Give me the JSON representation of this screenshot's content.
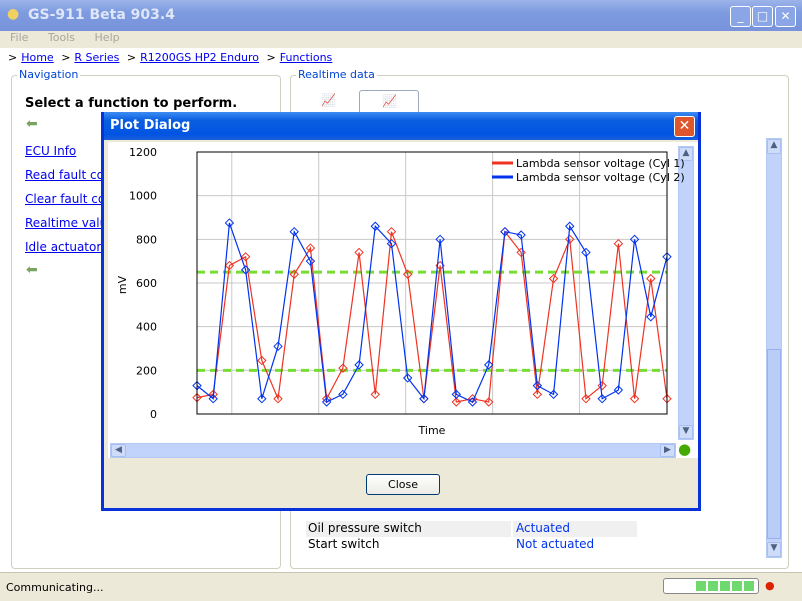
{
  "window": {
    "title": "GS-911 Beta 903.4",
    "min": "_",
    "max": "□",
    "close": "✕"
  },
  "menu": [
    "File",
    "Tools",
    "Help"
  ],
  "breadcrumb": {
    "sep": ">",
    "items": [
      "Home",
      "R Series",
      "R1200GS HP2 Enduro",
      "Functions"
    ]
  },
  "navigation": {
    "label": "Navigation",
    "heading": "Select a function to perform.",
    "links": [
      "ECU Info",
      "Read fault co",
      "Clear fault co",
      "Realtime valu",
      "Idle actuator"
    ]
  },
  "realtime": {
    "label": "Realtime data",
    "rows": [
      {
        "name": "Oil pressure switch",
        "value": "Actuated"
      },
      {
        "name": "Start switch",
        "value": "Not actuated"
      }
    ]
  },
  "status": {
    "text": "Communicating...",
    "progress_blocks": 5
  },
  "dialog": {
    "title": "Plot Dialog",
    "close_label": "Close",
    "status_led": "#44aa00"
  },
  "colors": {
    "cyl1": "#ee3322",
    "cyl2": "#0033ee",
    "threshold": "#77dd33"
  },
  "chart_data": {
    "type": "line",
    "xlabel": "Time",
    "ylabel": "mV",
    "ylim": [
      0,
      1200
    ],
    "yticks": [
      0,
      200,
      400,
      600,
      800,
      1000,
      1200
    ],
    "grid": true,
    "legend": "top-right",
    "thresholds": [
      650,
      200
    ],
    "x": [
      0,
      1,
      2,
      3,
      4,
      5,
      6,
      7,
      8,
      9,
      10,
      11,
      12,
      13,
      14,
      15,
      16,
      17,
      18,
      19,
      20,
      21,
      22,
      23,
      24,
      25,
      26,
      27,
      28,
      29
    ],
    "series": [
      {
        "name": "Lambda sensor voltage (Cyl 1)",
        "values": [
          75,
          90,
          680,
          720,
          245,
          70,
          640,
          760,
          70,
          210,
          740,
          90,
          835,
          640,
          70,
          680,
          55,
          70,
          55,
          835,
          740,
          90,
          620,
          800,
          70,
          130,
          780,
          70,
          620,
          70
        ]
      },
      {
        "name": "Lambda sensor voltage (Cyl 2)",
        "values": [
          130,
          70,
          875,
          660,
          70,
          310,
          835,
          700,
          55,
          90,
          225,
          860,
          780,
          165,
          70,
          800,
          90,
          55,
          225,
          835,
          820,
          130,
          90,
          860,
          740,
          70,
          110,
          800,
          445,
          720
        ]
      }
    ]
  }
}
